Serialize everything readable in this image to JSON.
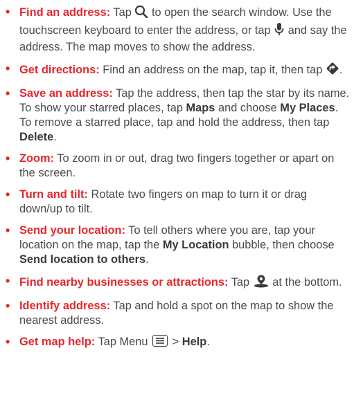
{
  "tips": [
    {
      "title": "Find an address:",
      "t1": " Tap ",
      "t2": " to open the search window. Use the touchscreen keyboard to enter the address, or tap ",
      "t3": " and say the address. The map moves to show the address.",
      "icon1": "search-icon",
      "icon2": "microphone-icon"
    },
    {
      "title": "Get directions:",
      "t1": " Find an address on the map, tap it, then tap ",
      "t2": ".",
      "icon1": "directions-icon"
    },
    {
      "title": "Save an address:",
      "t1": " Tap the address, then tap the star by its name. To show your starred places, tap ",
      "b1": "Maps",
      "t2": " and choose ",
      "b2": "My Places",
      "t3": ". To remove a starred place, tap and hold the address, then tap ",
      "b3": "Delete",
      "t4": "."
    },
    {
      "title": "Zoom:",
      "t1": " To zoom in or out, drag two fingers together or apart on the screen."
    },
    {
      "title": "Turn and tilt:",
      "t1": " Rotate two fingers on map to turn it or drag down/up to tilt."
    },
    {
      "title": "Send your location:",
      "t1": " To tell others where you are, tap your location on the map, tap the ",
      "b1": "My Location",
      "t2": " bubble, then choose ",
      "b2": "Send location to others",
      "t3": "."
    },
    {
      "title": "Find nearby businesses or attractions:",
      "t1": " Tap ",
      "t2": " at the bottom.",
      "icon1": "explore-pin-icon"
    },
    {
      "title": "Identify address:",
      "t1": " Tap and hold a spot on the map to show the nearest address."
    },
    {
      "title": "Get map help:",
      "t1": " Tap Menu ",
      "t2": " > ",
      "b1": "Help",
      "t3": ".",
      "icon1": "menu-icon"
    }
  ],
  "bullet": "•",
  "colors": {
    "accent": "#e8262d",
    "text": "#4a4a4a"
  }
}
